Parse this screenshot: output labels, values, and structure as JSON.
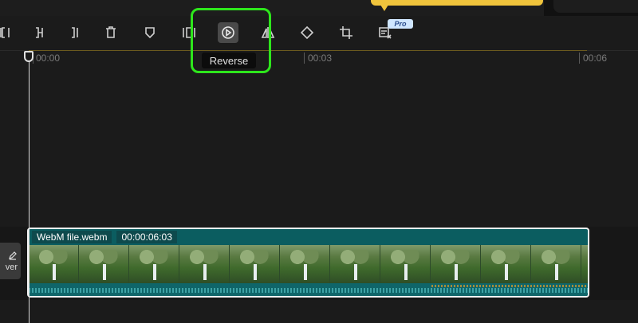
{
  "tooltip": {
    "text": "Reverse"
  },
  "pro_badge": {
    "text": "Pro"
  },
  "ruler": {
    "labels": [
      "00:00",
      "00:03",
      "00:06"
    ]
  },
  "cover": {
    "label": "ver"
  },
  "clip": {
    "name": "WebM file.webm",
    "duration": "00:00:06:03"
  },
  "toolbar": {
    "icons": [
      "split-start-icon",
      "split-mid-icon",
      "split-end-icon",
      "delete-icon",
      "mask-icon",
      "freeze-icon",
      "reverse-icon",
      "mirror-icon",
      "rotate-icon",
      "crop-icon",
      "remove-watermark-icon"
    ]
  },
  "colors": {
    "highlight": "#2ee61c",
    "clip": "#0b5d60",
    "banner": "#f0c43c"
  }
}
